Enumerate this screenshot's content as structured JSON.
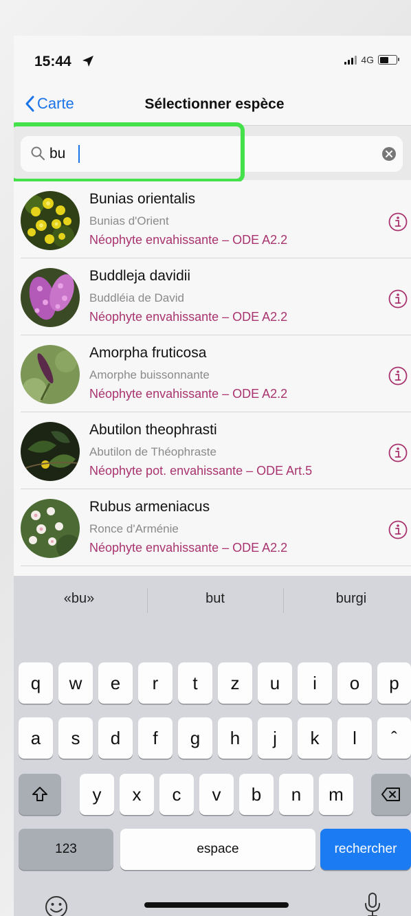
{
  "status_bar": {
    "time": "15:44",
    "network": "4G"
  },
  "nav": {
    "back_label": "Carte",
    "title": "Sélectionner espèce"
  },
  "search": {
    "value": "bu",
    "placeholder": ""
  },
  "results": [
    {
      "scientific_name": "Bunias orientalis",
      "common_name": "Bunias d'Orient",
      "status": "Néophyte envahissante – ODE A2.2"
    },
    {
      "scientific_name": "Buddleja davidii",
      "common_name": "Buddléia de David",
      "status": "Néophyte envahissante – ODE A2.2"
    },
    {
      "scientific_name": "Amorpha fruticosa",
      "common_name": "Amorphe buissonnante",
      "status": "Néophyte envahissante – ODE A2.2"
    },
    {
      "scientific_name": "Abutilon theophrasti",
      "common_name": "Abutilon de Théophraste",
      "status": "Néophyte pot. envahissante – ODE Art.5"
    },
    {
      "scientific_name": "Rubus armeniacus",
      "common_name": "Ronce d'Arménie",
      "status": "Néophyte envahissante – ODE A2.2"
    }
  ],
  "keyboard": {
    "suggestions": [
      "«bu»",
      "but",
      "burgi"
    ],
    "row1": [
      "q",
      "w",
      "e",
      "r",
      "t",
      "z",
      "u",
      "i",
      "o",
      "p"
    ],
    "row2": [
      "a",
      "s",
      "d",
      "f",
      "g",
      "h",
      "j",
      "k",
      "l",
      "ˆ"
    ],
    "row3": [
      "y",
      "x",
      "c",
      "v",
      "b",
      "n",
      "m"
    ],
    "numbers_label": "123",
    "space_label": "espace",
    "search_label": "rechercher"
  },
  "colors": {
    "accent": "#1a73e8",
    "status_text": "#a8336e",
    "highlight": "#45e14a"
  }
}
